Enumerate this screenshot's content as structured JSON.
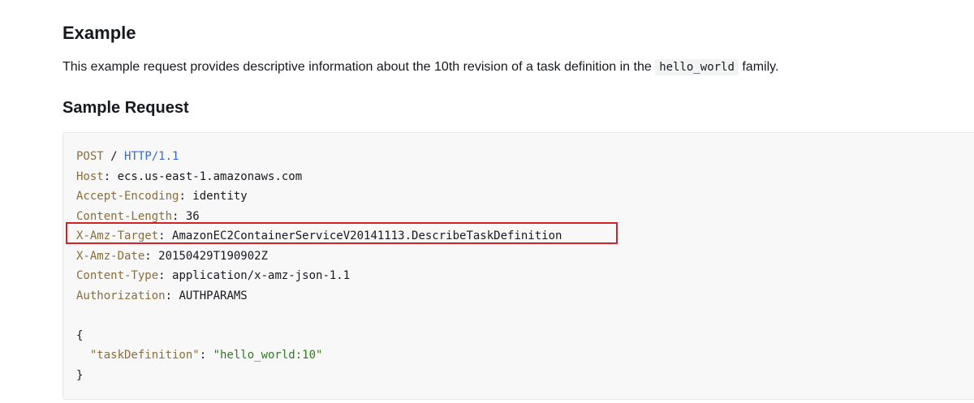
{
  "example": {
    "heading": "Example",
    "description_before": "This example request provides descriptive information about the 10th revision of a task definition in the ",
    "description_code": "hello_world",
    "description_after": " family."
  },
  "sample_request": {
    "heading": "Sample Request",
    "request_line": {
      "method": "POST",
      "path": "/",
      "version": "HTTP/1.1"
    },
    "headers": [
      {
        "name": "Host",
        "value": "ecs.us-east-1.amazonaws.com"
      },
      {
        "name": "Accept-Encoding",
        "value": "identity"
      },
      {
        "name": "Content-Length",
        "value": "36"
      },
      {
        "name": "X-Amz-Target",
        "value": "AmazonEC2ContainerServiceV20141113.DescribeTaskDefinition"
      },
      {
        "name": "X-Amz-Date",
        "value": "20150429T190902Z"
      },
      {
        "name": "Content-Type",
        "value": "application/x-amz-json-1.1"
      },
      {
        "name": "Authorization",
        "value": "AUTHPARAMS"
      }
    ],
    "body": {
      "open_brace": "{",
      "key": "\"taskDefinition\"",
      "value": "\"hello_world:10\"",
      "close_brace": "}"
    }
  },
  "colors": {
    "highlight_border": "#d42027",
    "header_name": "#8a6d3b",
    "url": "#2f6bd1",
    "string": "#2f7a1f",
    "code_background": "#f8f8f8"
  }
}
